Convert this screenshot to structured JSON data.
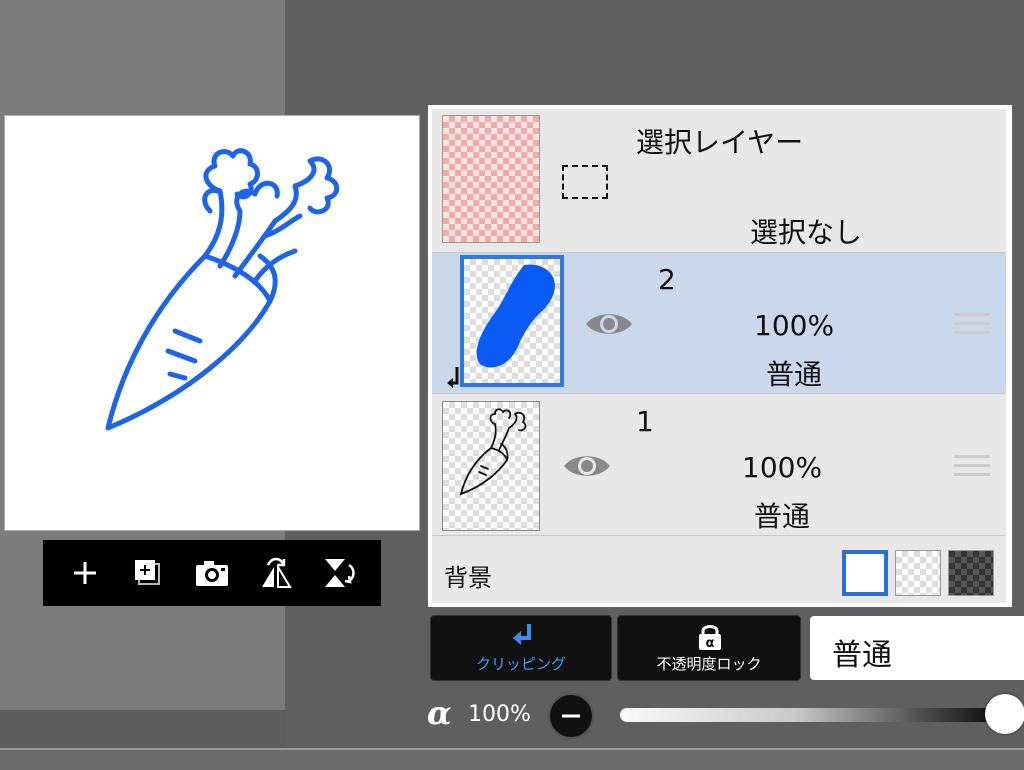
{
  "toolbar": {
    "icons": [
      "add-icon",
      "add-layer-icon",
      "camera-icon",
      "flip-horizontal-icon",
      "flip-vertical-icon"
    ]
  },
  "layers": {
    "selection": {
      "title": "選択レイヤー",
      "status": "選択なし"
    },
    "layer2": {
      "name": "2",
      "opacity": "100%",
      "blend": "普通"
    },
    "layer1": {
      "name": "1",
      "opacity": "100%",
      "blend": "普通"
    },
    "background": {
      "label": "背景"
    }
  },
  "buttons": {
    "clipping": "クリッピング",
    "opacity_lock": "不透明度ロック",
    "blend_mode": "普通"
  },
  "opacity": {
    "alpha_symbol": "α",
    "value_label": "100%",
    "value": 1.0
  },
  "colors": {
    "accent_blue": "#1e64e6",
    "selection_highlight": "#cbd8ec",
    "swatch_border": "#2b6fd6"
  }
}
